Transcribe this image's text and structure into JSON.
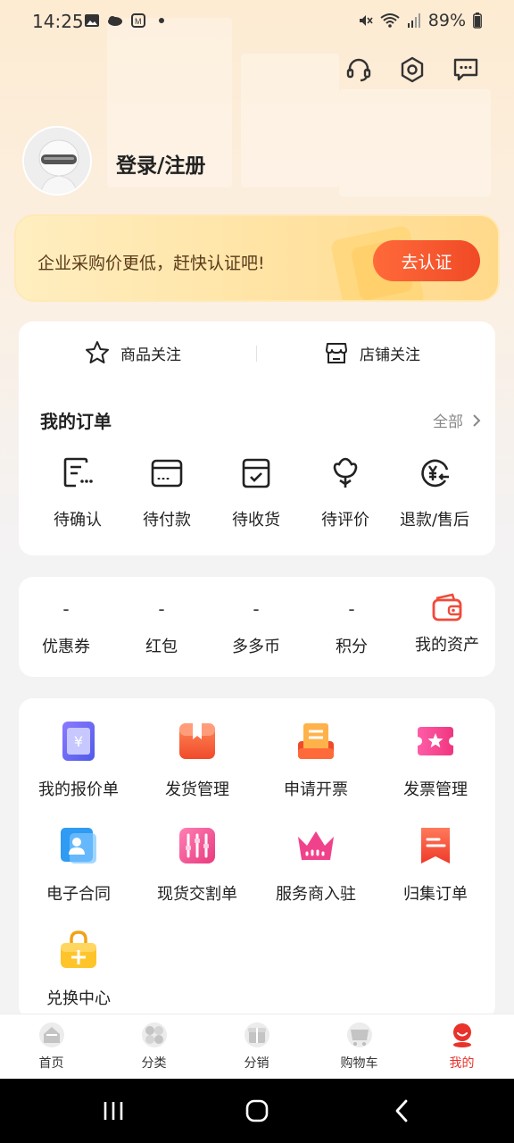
{
  "status_bar": {
    "time": "14:25",
    "battery": "89%"
  },
  "profile": {
    "login_label": "登录/注册"
  },
  "cert_banner": {
    "text": "企业采购价更低，赶快认证吧!",
    "button_label": "去认证"
  },
  "follow": {
    "product_label": "商品关注",
    "store_label": "店铺关注"
  },
  "orders": {
    "title": "我的订单",
    "all_label": "全部",
    "items": [
      {
        "label": "待确认",
        "icon": "pending-confirm-icon"
      },
      {
        "label": "待付款",
        "icon": "pending-payment-icon"
      },
      {
        "label": "待收货",
        "icon": "pending-receipt-icon"
      },
      {
        "label": "待评价",
        "icon": "pending-review-icon"
      },
      {
        "label": "退款/售后",
        "icon": "refund-icon"
      }
    ]
  },
  "assets": {
    "items": [
      {
        "value": "-",
        "label": "优惠券"
      },
      {
        "value": "-",
        "label": "红包"
      },
      {
        "value": "-",
        "label": "多多币"
      },
      {
        "value": "-",
        "label": "积分"
      }
    ],
    "wallet_label": "我的资产"
  },
  "tools": {
    "items": [
      {
        "label": "我的报价单",
        "icon": "quote-icon"
      },
      {
        "label": "发货管理",
        "icon": "shipping-icon"
      },
      {
        "label": "申请开票",
        "icon": "invoice-apply-icon"
      },
      {
        "label": "发票管理",
        "icon": "invoice-manage-icon"
      },
      {
        "label": "电子合同",
        "icon": "contract-icon"
      },
      {
        "label": "现货交割单",
        "icon": "delivery-note-icon"
      },
      {
        "label": "服务商入驻",
        "icon": "crown-icon"
      },
      {
        "label": "归集订单",
        "icon": "collect-order-icon"
      },
      {
        "label": "兑换中心",
        "icon": "exchange-icon"
      }
    ]
  },
  "bottom_nav": {
    "items": [
      {
        "label": "首页"
      },
      {
        "label": "分类"
      },
      {
        "label": "分销"
      },
      {
        "label": "购物车"
      },
      {
        "label": "我的"
      }
    ]
  },
  "colors": {
    "accent": "#e8322b",
    "cert_button": "#f04a26",
    "banner": "#ffe3a3"
  }
}
